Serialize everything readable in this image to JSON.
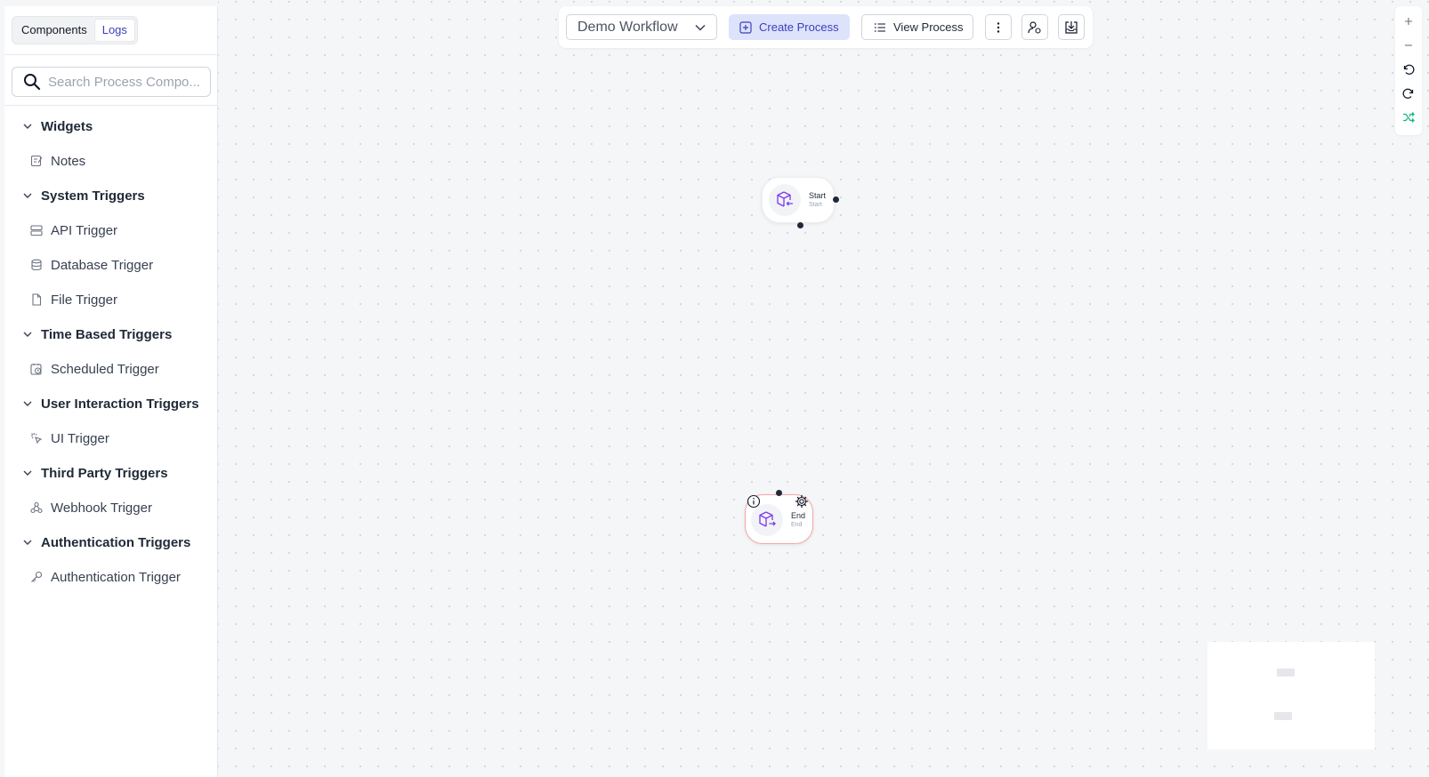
{
  "sidebar": {
    "tabs": [
      {
        "label": "Components"
      },
      {
        "label": "Logs"
      }
    ],
    "search": {
      "placeholder": "Search Process Compo...",
      "value": ""
    },
    "groups": [
      {
        "label": "Widgets",
        "items": [
          {
            "label": "Notes",
            "icon": "notes-icon"
          }
        ]
      },
      {
        "label": "System Triggers",
        "items": [
          {
            "label": "API Trigger",
            "icon": "server-icon"
          },
          {
            "label": "Database Trigger",
            "icon": "database-icon"
          },
          {
            "label": "File Trigger",
            "icon": "file-icon"
          }
        ]
      },
      {
        "label": "Time Based Triggers",
        "items": [
          {
            "label": "Scheduled Trigger",
            "icon": "calendar-clock-icon"
          }
        ]
      },
      {
        "label": "User Interaction Triggers",
        "items": [
          {
            "label": "UI Trigger",
            "icon": "pointer-click-icon"
          }
        ]
      },
      {
        "label": "Third Party Triggers",
        "items": [
          {
            "label": "Webhook Trigger",
            "icon": "webhook-icon"
          }
        ]
      },
      {
        "label": "Authentication Triggers",
        "items": [
          {
            "label": "Authentication Trigger",
            "icon": "key-icon"
          }
        ]
      }
    ]
  },
  "toolbar": {
    "workflow_select": "Demo Workflow",
    "create_label": "Create Process",
    "view_label": "View Process"
  },
  "nodes": {
    "start": {
      "title": "Start",
      "subtitle": "Start"
    },
    "end": {
      "title": "End",
      "subtitle": "End"
    }
  },
  "colors": {
    "accent": "#3b3fbf",
    "accent_bg": "#dde3fa",
    "node_icon": "#7c3aed",
    "end_border": "#f4a6a6",
    "shuffle_icon": "#10b981"
  }
}
